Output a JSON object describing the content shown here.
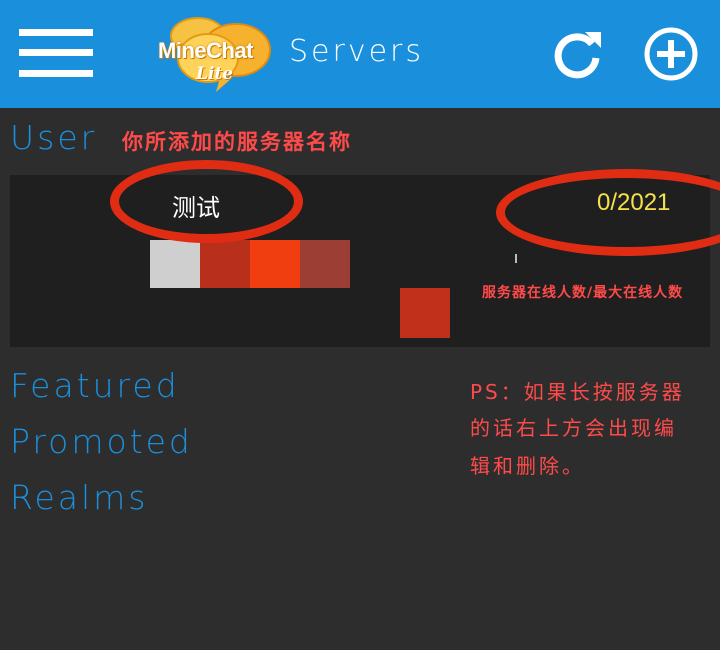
{
  "appbar": {
    "logo_text": "MineChat",
    "logo_sub": "Lite",
    "title": "Servers",
    "icons": {
      "menu": "hamburger-menu-icon",
      "refresh": "refresh-icon",
      "add": "add-circle-icon"
    }
  },
  "colors": {
    "appbar": "#1a90dd",
    "background": "#2d2d2d",
    "card": "#1f1f1f",
    "section_text": "#1a90dd",
    "player_count": "#f4e24a",
    "annotation": "#ff4a4a",
    "highlight_ring": "#e12c14"
  },
  "sections": {
    "user": "User",
    "featured": "Featured",
    "promoted": "Promoted",
    "realms": "Realms"
  },
  "server": {
    "name": "测试",
    "players": "0/2021"
  },
  "annotations": {
    "server_name_note": "你所添加的服务器名称",
    "player_count_note": "服务器在线人数/最大在线人数",
    "ps_line1": "PS：如果长按服务器",
    "ps_line2": "的话右上方会出现编",
    "ps_line3": "辑和删除。"
  }
}
